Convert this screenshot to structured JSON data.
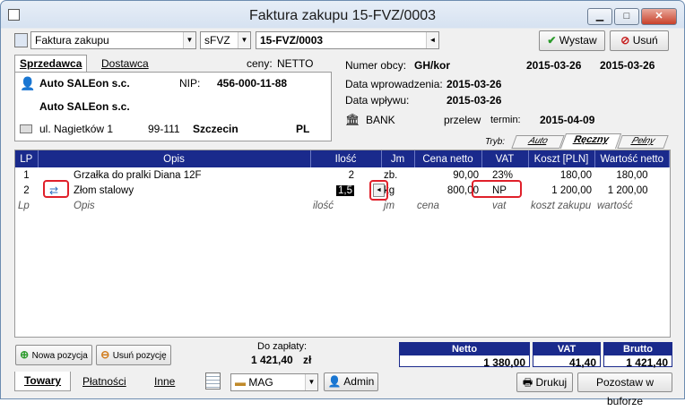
{
  "window": {
    "title": "Faktura zakupu 15-FVZ/0003"
  },
  "toolbar": {
    "doc_type": "Faktura zakupu",
    "series": "sFVZ",
    "number": "15-FVZ/0003",
    "wystaw": "Wystaw",
    "usun": "Usuń"
  },
  "party": {
    "tab_seller": "Sprzedawca",
    "tab_supplier": "Dostawca",
    "prices_label": "ceny:",
    "prices_value": "NETTO",
    "name1": "Auto SALEon s.c.",
    "nip_label": "NIP:",
    "nip": "456-000-11-88",
    "name2": "Auto SALEon s.c.",
    "street": "ul. Nagietków 1",
    "zip": "99-111",
    "city": "Szczecin",
    "country": "PL"
  },
  "doc": {
    "ext_num_label": "Numer obcy:",
    "ext_num": "GH/kor",
    "date1": "2015-03-26",
    "date2": "2015-03-26",
    "entered_label": "Data wprowadzenia:",
    "entered": "2015-03-26",
    "received_label": "Data wpływu:",
    "received": "2015-03-26",
    "payment": "BANK",
    "method": "przelew",
    "term_label": "termin:",
    "term": "2015-04-09"
  },
  "mode": {
    "label": "Tryb:",
    "tabs": [
      "Auto",
      "Ręczny",
      "Pełny"
    ]
  },
  "grid": {
    "headers": [
      "LP",
      "Opis",
      "Ilość",
      "Jm",
      "Cena netto",
      "VAT",
      "Koszt [PLN]",
      "Wartość netto"
    ],
    "rows": [
      [
        "1",
        "Grzałka do pralki Diana 12F",
        "2",
        "zb.",
        "90,00",
        "23%",
        "180,00",
        "180,00"
      ],
      [
        "2",
        "Złom stalowy",
        "1,5",
        "kg",
        "800,00",
        "NP",
        "1 200,00",
        "1 200,00"
      ]
    ],
    "hint": [
      "Lp",
      "Opis",
      "ilość",
      "jm",
      "cena",
      "vat",
      "koszt zakupu",
      "wartość"
    ]
  },
  "bottom": {
    "add": "Nowa pozycja",
    "remove": "Usuń pozycję",
    "due_label": "Do zapłaty:",
    "due": "1 421,40",
    "currency": "zł"
  },
  "totals": {
    "netto_label": "Netto",
    "netto": "1 380,00",
    "vat_label": "VAT",
    "vat": "41,40",
    "brutto_label": "Brutto",
    "brutto": "1 421,40"
  },
  "footer": {
    "tabs": [
      "Towary",
      "Płatności",
      "Inne"
    ],
    "warehouse": "MAG",
    "user": "Admin",
    "print": "Drukuj",
    "buffer": "Pozostaw w buforze"
  }
}
